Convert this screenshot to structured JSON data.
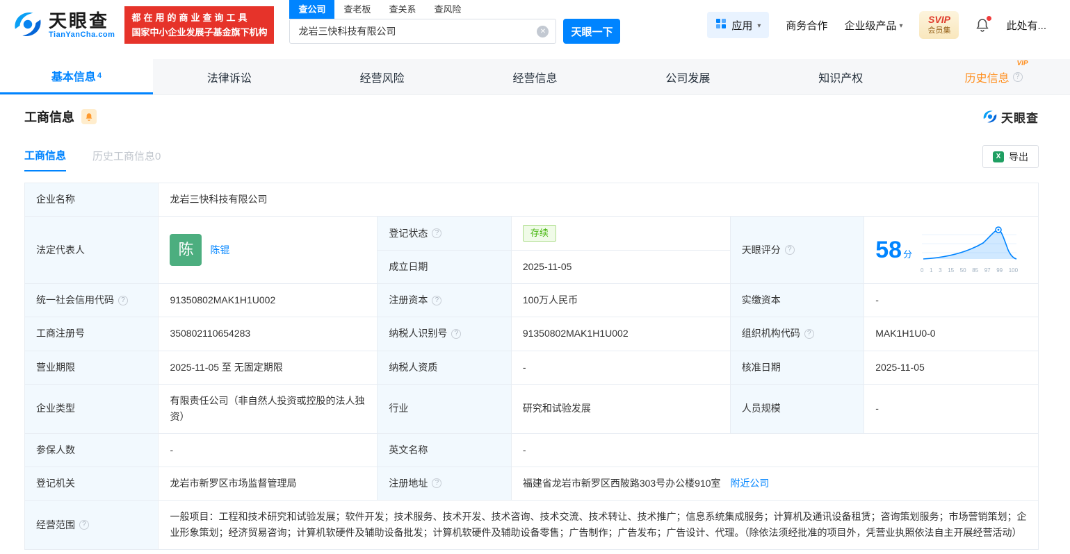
{
  "icons": {
    "help": "?",
    "clear": "✕",
    "caret": "▾",
    "excel": "X"
  },
  "header": {
    "logo_title": "天眼查",
    "logo_subtitle": "TianYanCha.com",
    "slogan_line1": "都在用的商业查询工具",
    "slogan_line2": "国家中小企业发展子基金旗下机构",
    "search_tabs": [
      {
        "label": "查公司"
      },
      {
        "label": "查老板"
      },
      {
        "label": "查关系"
      },
      {
        "label": "查风险"
      }
    ],
    "search_value": "龙岩三快科技有限公司",
    "search_button": "天眼一下",
    "apps_label": "应用",
    "cooperation_label": "商务合作",
    "enterprise_label": "企业级产品",
    "svip_top": "SVIP",
    "svip_bottom": "会员集",
    "more_label": "此处有..."
  },
  "nav_tabs": [
    {
      "label": "基本信息",
      "count": "4"
    },
    {
      "label": "法律诉讼"
    },
    {
      "label": "经营风险"
    },
    {
      "label": "经营信息"
    },
    {
      "label": "公司发展"
    },
    {
      "label": "知识产权"
    },
    {
      "label": "历史信息",
      "vip": "VIP"
    }
  ],
  "section": {
    "title": "工商信息",
    "brand": "天眼查",
    "tab_current": "工商信息",
    "tab_history": "历史工商信息0",
    "export_label": "导出"
  },
  "table": {
    "company_name_label": "企业名称",
    "company_name": "龙岩三快科技有限公司",
    "legal_rep_label": "法定代表人",
    "legal_rep_avatar": "陈",
    "legal_rep_name": "陈锟",
    "reg_status_label": "登记状态",
    "reg_status": "存续",
    "establish_date_label": "成立日期",
    "establish_date": "2025-11-05",
    "score_label": "天眼评分",
    "credit_code_label": "统一社会信用代码",
    "credit_code": "91350802MAK1H1U002",
    "reg_capital_label": "注册资本",
    "reg_capital": "100万人民币",
    "paid_capital_label": "实缴资本",
    "paid_capital": "-",
    "reg_number_label": "工商注册号",
    "reg_number": "350802110654283",
    "taxpayer_id_label": "纳税人识别号",
    "taxpayer_id": "91350802MAK1H1U002",
    "org_code_label": "组织机构代码",
    "org_code": "MAK1H1U0-0",
    "business_term_label": "营业期限",
    "business_term": "2025-11-05 至 无固定期限",
    "taxpayer_quality_label": "纳税人资质",
    "taxpayer_quality": "-",
    "approval_date_label": "核准日期",
    "approval_date": "2025-11-05",
    "company_type_label": "企业类型",
    "company_type": "有限责任公司（非自然人投资或控股的法人独资）",
    "industry_label": "行业",
    "industry": "研究和试验发展",
    "staff_size_label": "人员规模",
    "staff_size": "-",
    "insured_label": "参保人数",
    "insured": "-",
    "english_name_label": "英文名称",
    "english_name": "-",
    "reg_authority_label": "登记机关",
    "reg_authority": "龙岩市新罗区市场监督管理局",
    "reg_address_label": "注册地址",
    "reg_address": "福建省龙岩市新罗区西陂路303号办公楼910室",
    "nearby_link": "附近公司",
    "business_scope_label": "经营范围",
    "business_scope": "一般项目：工程和技术研究和试验发展；软件开发；技术服务、技术开发、技术咨询、技术交流、技术转让、技术推广；信息系统集成服务；计算机及通讯设备租赁；咨询策划服务；市场营销策划；企业形象策划；经济贸易咨询；计算机软硬件及辅助设备批发；计算机软硬件及辅助设备零售；广告制作；广告发布；广告设计、代理。（除依法须经批准的项目外，凭营业执照依法自主开展经营活动）"
  },
  "chart_data": {
    "type": "line",
    "title": "天眼评分",
    "score": 58,
    "score_unit": "分",
    "x_ticks": [
      "0",
      "1",
      "3",
      "15",
      "50",
      "85",
      "97",
      "99",
      "100"
    ],
    "curve_shape": "percentile-bell",
    "accent_color": "#0084ff"
  }
}
